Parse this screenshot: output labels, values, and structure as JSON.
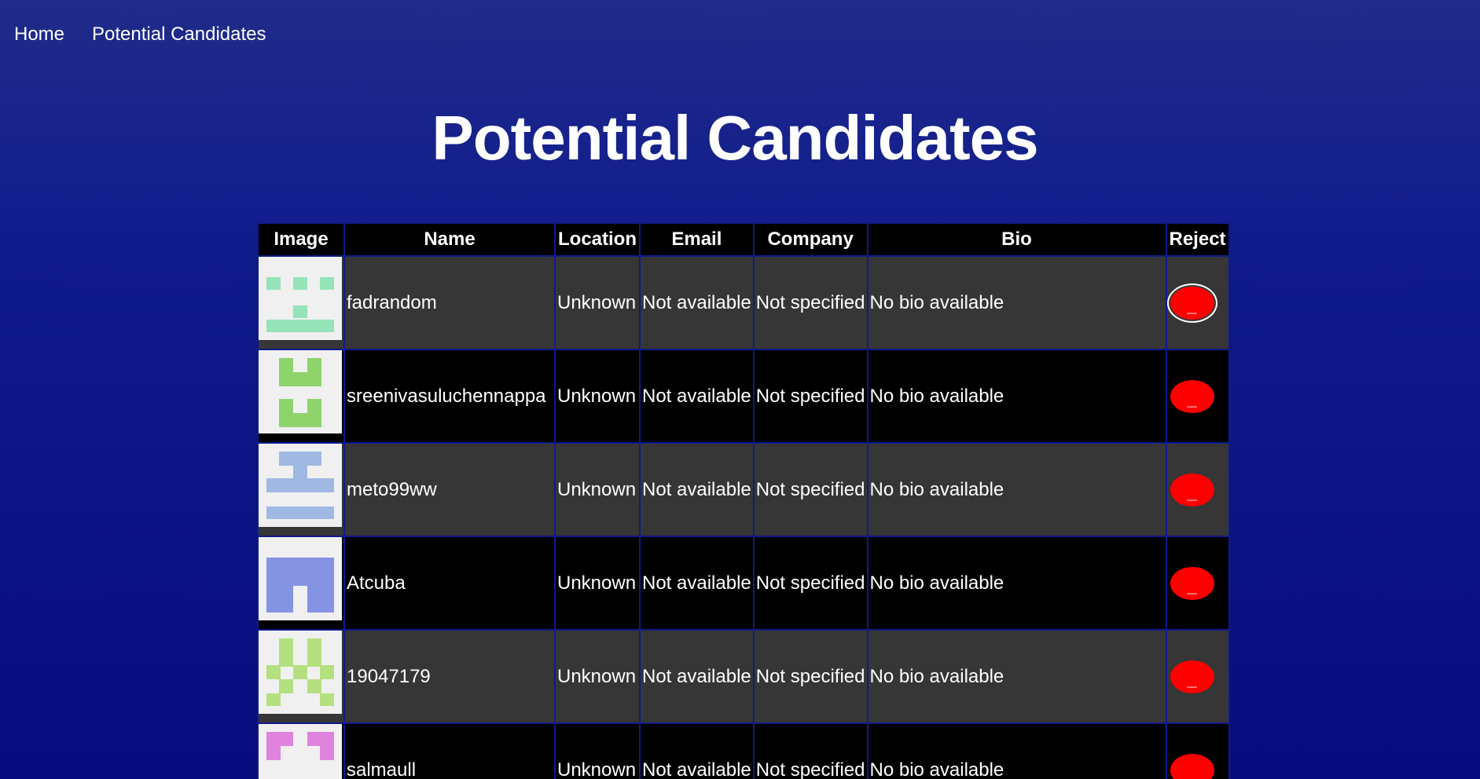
{
  "nav": {
    "home": "Home",
    "candidates": "Potential Candidates"
  },
  "title": "Potential Candidates",
  "table": {
    "headers": [
      "Image",
      "Name",
      "Location",
      "Email",
      "Company",
      "Bio",
      "Reject"
    ],
    "rows": [
      {
        "name": "fadrandom",
        "location": "Unknown",
        "email": "Not available",
        "company": "Not specified",
        "bio": "No bio available",
        "reject": "_",
        "avatar_color": "#95e3b9"
      },
      {
        "name": "sreenivasuluchennappa",
        "location": "Unknown",
        "email": "Not available",
        "company": "Not specified",
        "bio": "No bio available",
        "reject": "_",
        "avatar_color": "#8fd36b"
      },
      {
        "name": "meto99ww",
        "location": "Unknown",
        "email": "Not available",
        "company": "Not specified",
        "bio": "No bio available",
        "reject": "_",
        "avatar_color": "#a0b9e3"
      },
      {
        "name": "Atcuba",
        "location": "Unknown",
        "email": "Not available",
        "company": "Not specified",
        "bio": "No bio available",
        "reject": "_",
        "avatar_color": "#8593e3"
      },
      {
        "name": "19047179",
        "location": "Unknown",
        "email": "Not available",
        "company": "Not specified",
        "bio": "No bio available",
        "reject": "_",
        "avatar_color": "#b5e07f"
      },
      {
        "name": "salmaull",
        "location": "Unknown",
        "email": "Not available",
        "company": "Not specified",
        "bio": "No bio available",
        "reject": "_",
        "avatar_color": "#e083df"
      }
    ]
  },
  "colors": {
    "reject_button": "#ff0000",
    "row_dark": "#363636",
    "row_black": "#000000"
  }
}
